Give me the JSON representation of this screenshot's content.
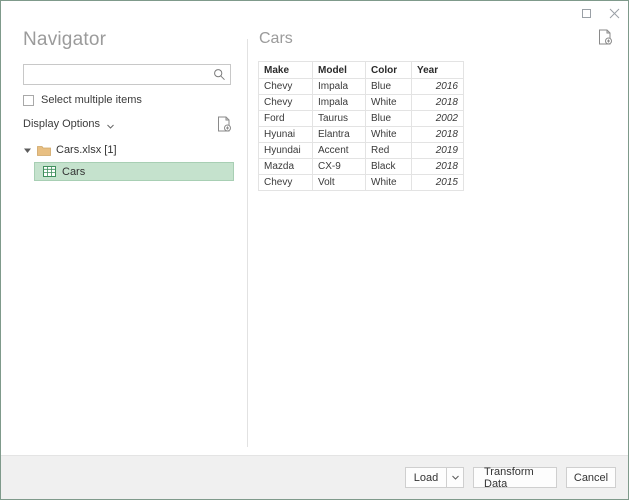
{
  "window": {
    "controls": [
      {
        "name": "maximize",
        "glyph": "maximize-icon"
      },
      {
        "name": "close",
        "glyph": "close-icon"
      }
    ]
  },
  "navigator": {
    "title": "Navigator",
    "search": {
      "value": "",
      "placeholder": ""
    },
    "select_multiple_label": "Select multiple items",
    "select_multiple_checked": false,
    "display_options_label": "Display Options",
    "tree": {
      "root": {
        "label": "Cars.xlsx [1]",
        "expanded": true
      },
      "children": [
        {
          "label": "Cars",
          "selected": true
        }
      ]
    }
  },
  "preview": {
    "title": "Cars",
    "columns": [
      "Make",
      "Model",
      "Color",
      "Year"
    ],
    "rows": [
      [
        "Chevy",
        "Impala",
        "Blue",
        "2016"
      ],
      [
        "Chevy",
        "Impala",
        "White",
        "2018"
      ],
      [
        "Ford",
        "Taurus",
        "Blue",
        "2002"
      ],
      [
        "Hyunai",
        "Elantra",
        "White",
        "2018"
      ],
      [
        "Hyundai",
        "Accent",
        "Red",
        "2019"
      ],
      [
        "Mazda",
        "CX-9",
        "Black",
        "2018"
      ],
      [
        "Chevy",
        "Volt",
        "White",
        "2015"
      ]
    ]
  },
  "footer": {
    "load_label": "Load",
    "transform_label": "Transform Data",
    "cancel_label": "Cancel"
  },
  "colors": {
    "window_border": "#7f9a8b",
    "selection_green": "#c5e2cd",
    "heading_gray": "#9b9b9b",
    "footer_bg": "#f0f0f0",
    "folder_tan": "#e8bf82",
    "table_icon_green": "#3f8f5c"
  }
}
